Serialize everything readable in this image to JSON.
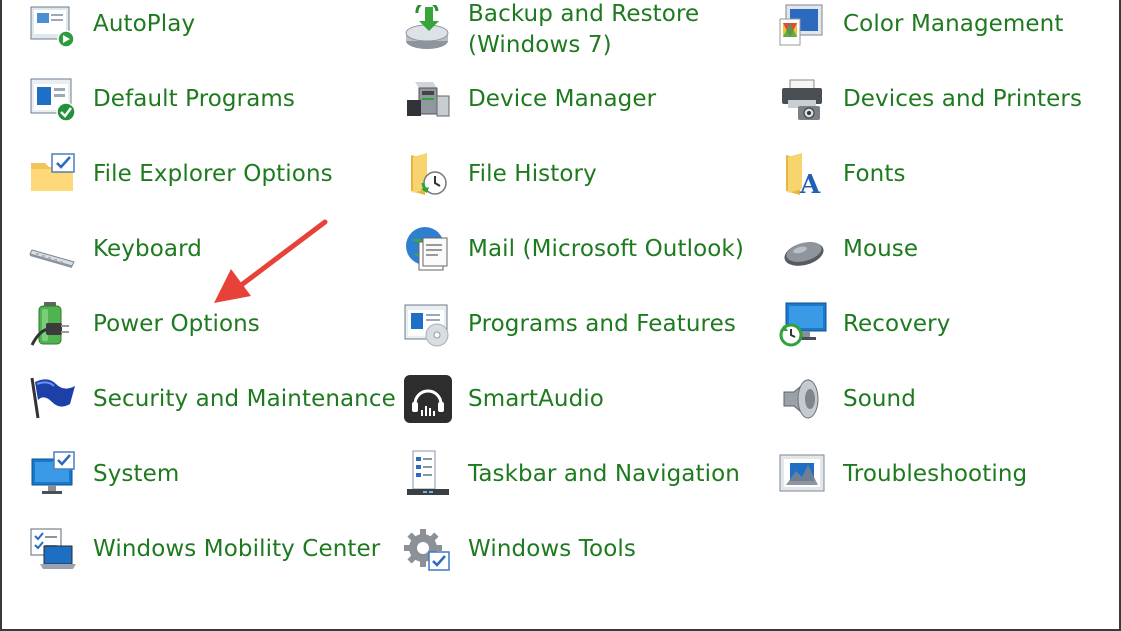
{
  "items": [
    {
      "label": "AutoPlay",
      "icon": "autoplay-icon"
    },
    {
      "label": "Backup and Restore\n(Windows 7)",
      "icon": "backup-restore-icon"
    },
    {
      "label": "Color Management",
      "icon": "color-management-icon"
    },
    {
      "label": "Default Programs",
      "icon": "default-programs-icon"
    },
    {
      "label": "Device Manager",
      "icon": "device-manager-icon"
    },
    {
      "label": "Devices and Printers",
      "icon": "devices-printers-icon"
    },
    {
      "label": "File Explorer Options",
      "icon": "folder-options-icon"
    },
    {
      "label": "File History",
      "icon": "file-history-icon"
    },
    {
      "label": "Fonts",
      "icon": "fonts-icon"
    },
    {
      "label": "Keyboard",
      "icon": "keyboard-icon"
    },
    {
      "label": "Mail (Microsoft Outlook)",
      "icon": "mail-icon"
    },
    {
      "label": "Mouse",
      "icon": "mouse-icon"
    },
    {
      "label": "Power Options",
      "icon": "battery-plug-icon"
    },
    {
      "label": "Programs and Features",
      "icon": "programs-features-icon"
    },
    {
      "label": "Recovery",
      "icon": "recovery-icon"
    },
    {
      "label": "Security and Maintenance",
      "icon": "flag-icon"
    },
    {
      "label": "SmartAudio",
      "icon": "headphones-icon"
    },
    {
      "label": "Sound",
      "icon": "speaker-icon"
    },
    {
      "label": "System",
      "icon": "monitor-check-icon"
    },
    {
      "label": "Taskbar and Navigation",
      "icon": "taskbar-icon"
    },
    {
      "label": "Troubleshooting",
      "icon": "troubleshooting-icon"
    },
    {
      "label": "Windows Mobility Center",
      "icon": "mobility-center-icon"
    },
    {
      "label": "Windows Tools",
      "icon": "gear-icon"
    }
  ],
  "colors": {
    "link": "#1e7a1e",
    "annotation_arrow": "#e8413a"
  }
}
